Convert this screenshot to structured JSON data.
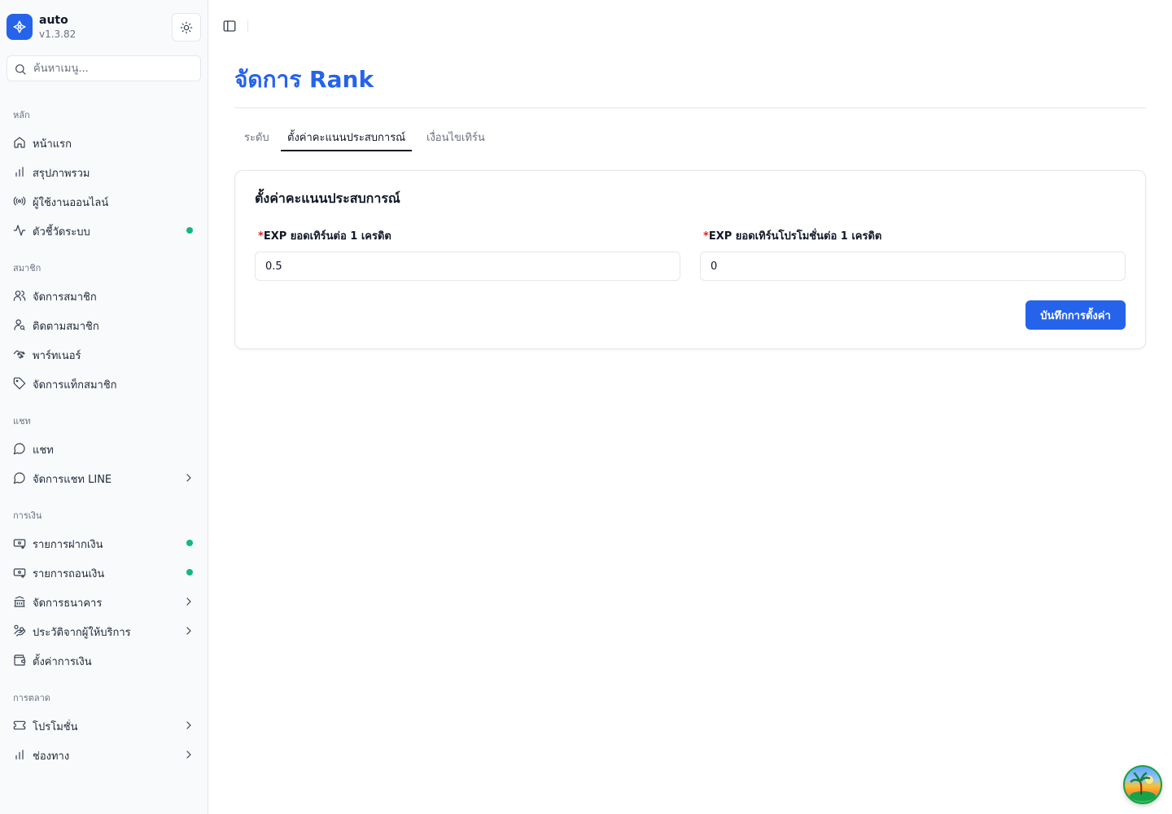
{
  "app": {
    "name": "auto",
    "version": "v1.3.82"
  },
  "search": {
    "placeholder": "ค้นหาเมนู..."
  },
  "sidebar": {
    "sections": {
      "main": "หลัก",
      "members": "สมาชิก",
      "chat": "แชท",
      "finance": "การเงิน",
      "marketing": "การตลาด"
    },
    "items": [
      {
        "label": "หน้าแรก",
        "icon": "home-icon"
      },
      {
        "label": "สรุปภาพรวม",
        "icon": "bar-chart-icon"
      },
      {
        "label": "ผู้ใช้งานออนไลน์",
        "icon": "radio-icon"
      },
      {
        "label": "ตัวชี้วัดระบบ",
        "icon": "activity-icon",
        "status": "online"
      },
      {
        "label": "จัดการสมาชิก",
        "icon": "users-icon"
      },
      {
        "label": "ติดตามสมาชิก",
        "icon": "user-search-icon"
      },
      {
        "label": "พาร์ทเนอร์",
        "icon": "handshake-icon"
      },
      {
        "label": "จัดการแท็กสมาชิก",
        "icon": "tag-icon"
      },
      {
        "label": "แชท",
        "icon": "chat-bubble-icon"
      },
      {
        "label": "จัดการแชท LINE",
        "icon": "chat-bubble-icon"
      },
      {
        "label": "รายการฝากเงิน",
        "icon": "deposit-icon",
        "status": "online"
      },
      {
        "label": "รายการถอนเงิน",
        "icon": "withdraw-icon",
        "status": "online"
      },
      {
        "label": "จัดการธนาคาร",
        "icon": "bank-icon"
      },
      {
        "label": "ประวัติจากผู้ให้บริการ",
        "icon": "hand-coins-icon"
      },
      {
        "label": "ตั้งค่าการเงิน",
        "icon": "wallet-icon"
      },
      {
        "label": "โปรโมชั่น",
        "icon": "ticket-icon"
      },
      {
        "label": "ช่องทาง",
        "icon": "bar-chart-icon"
      }
    ]
  },
  "page": {
    "title": "จัดการ Rank"
  },
  "tabs": [
    {
      "label": "ระดับ",
      "active": false
    },
    {
      "label": "ตั้งค่าคะแนนประสบการณ์",
      "active": true
    },
    {
      "label": "เงื่อนไขเทิร์น",
      "active": false
    }
  ],
  "card": {
    "title": "ตั้งค่าคะแนนประสบการณ์",
    "required_mark": "*",
    "fields": [
      {
        "label": "EXP ยอดเทิร์นต่อ 1 เครดิต",
        "value": "0.5"
      },
      {
        "label": "EXP ยอดเทิร์นโปรโมชั่นต่อ 1 เครดิต",
        "value": "0"
      }
    ],
    "save_label": "บันทึกการตั้งค่า"
  },
  "colors": {
    "accent": "#2563eb",
    "status_dot": "#10b981",
    "required": "#dc2626"
  }
}
